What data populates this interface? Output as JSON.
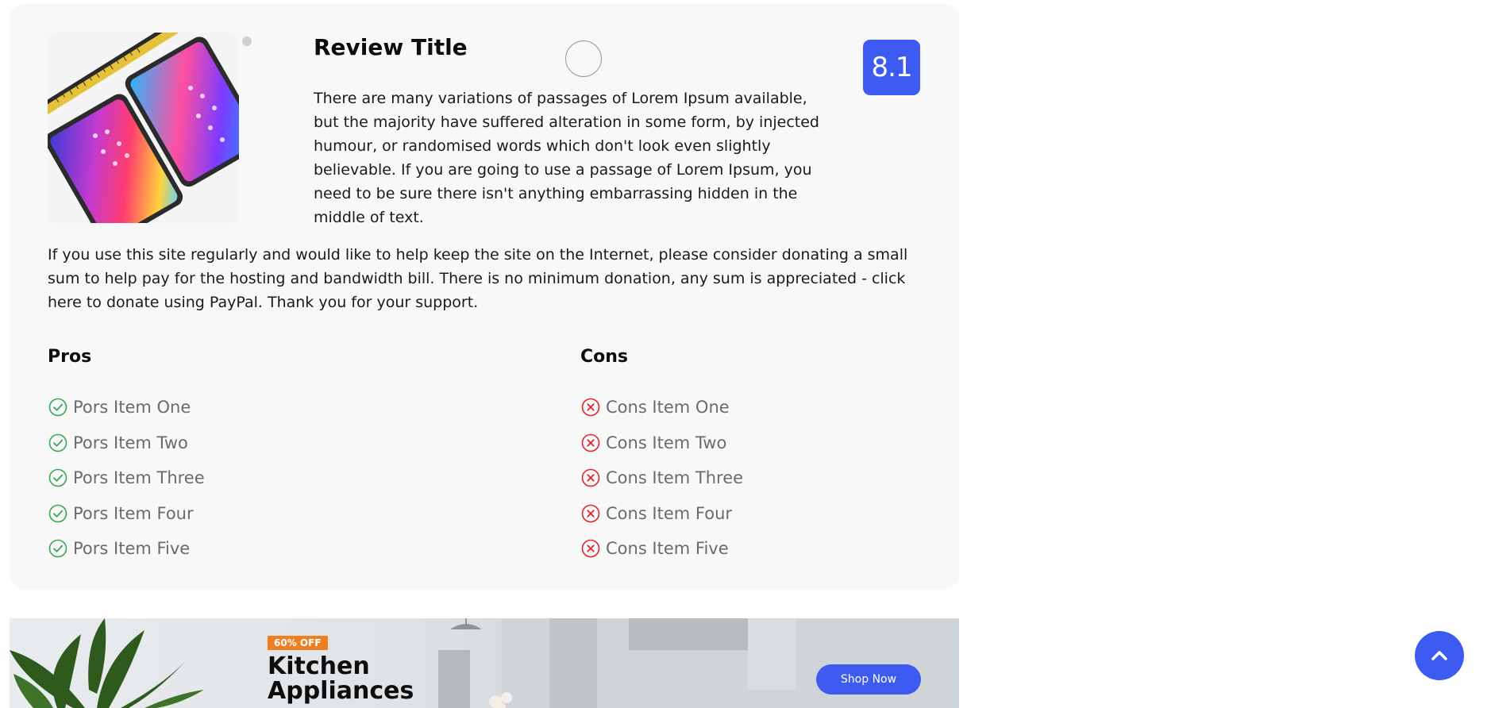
{
  "review": {
    "title": "Review Title",
    "score": "8.1",
    "description": "There are many variations of passages of Lorem Ipsum available, but the majority have suffered alteration in some form, by injected humour, or randomised words which don't look even slightly believable. If you are going to use a passage of Lorem Ipsum, you need to be sure there isn't anything embarrassing hidden in the middle of text.",
    "support_text": "If you use this site regularly and would like to help keep the site on the Internet, please consider donating a small sum to help pay for the hosting and bandwidth bill. There is no minimum donation, any sum is appreciated - click here to donate using PayPal. Thank you for your support."
  },
  "pros": {
    "heading": "Pros",
    "items": [
      "Pors Item One",
      "Pors Item Two",
      "Pors Item Three",
      "Pors Item Four",
      "Pors Item Five"
    ]
  },
  "cons": {
    "heading": "Cons",
    "items": [
      "Cons Item One",
      "Cons Item Two",
      "Cons Item Three",
      "Cons Item Four",
      "Cons Item Five"
    ]
  },
  "banner": {
    "discount": "60% OFF",
    "title_line1": "Kitchen",
    "title_line2": "Appliances",
    "button": "Shop Now"
  },
  "icons": {
    "pro": "check-circle-icon",
    "con": "x-circle-icon",
    "scroll": "chevron-up-icon"
  },
  "colors": {
    "accent": "#3d5af1",
    "pro": "#3aa655",
    "con": "#e0242b",
    "discount": "#f07f22",
    "card_bg": "#f8f8f8"
  }
}
